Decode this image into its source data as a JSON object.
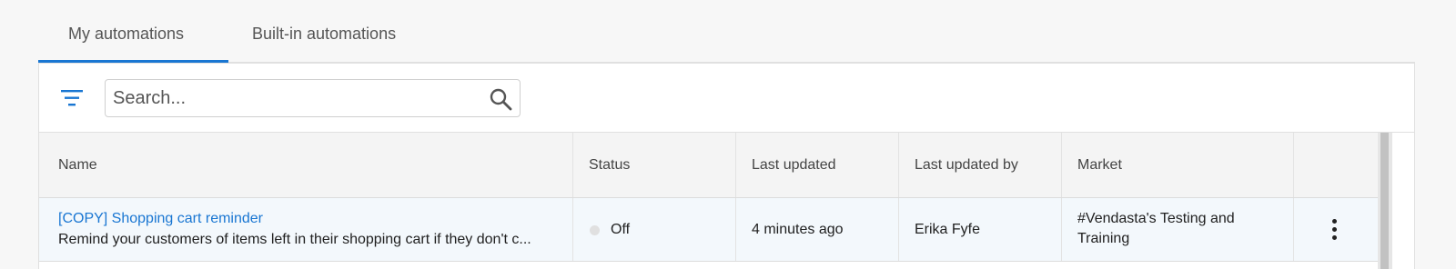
{
  "tabs": [
    {
      "label": "My automations",
      "active": true
    },
    {
      "label": "Built-in automations",
      "active": false
    }
  ],
  "toolbar": {
    "filter_icon": "filter-icon",
    "search_placeholder": "Search...",
    "search_value": "",
    "search_icon": "search-icon"
  },
  "table": {
    "columns": [
      "Name",
      "Status",
      "Last updated",
      "Last updated by",
      "Market"
    ],
    "rows": [
      {
        "name": "[COPY] Shopping cart reminder",
        "description": "Remind your customers of items left in their shopping cart if they don't c...",
        "status": "Off",
        "last_updated": "4 minutes ago",
        "last_updated_by": "Erika Fyfe",
        "market_line1": "#Vendasta's Testing and",
        "market_line2": "Training",
        "actions_icon": "more-vert-icon"
      }
    ]
  },
  "colors": {
    "accent": "#1976d2",
    "row_highlight": "#f3f8fc",
    "header_bg": "#f4f4f4",
    "status_off": "#e0e0e0"
  }
}
